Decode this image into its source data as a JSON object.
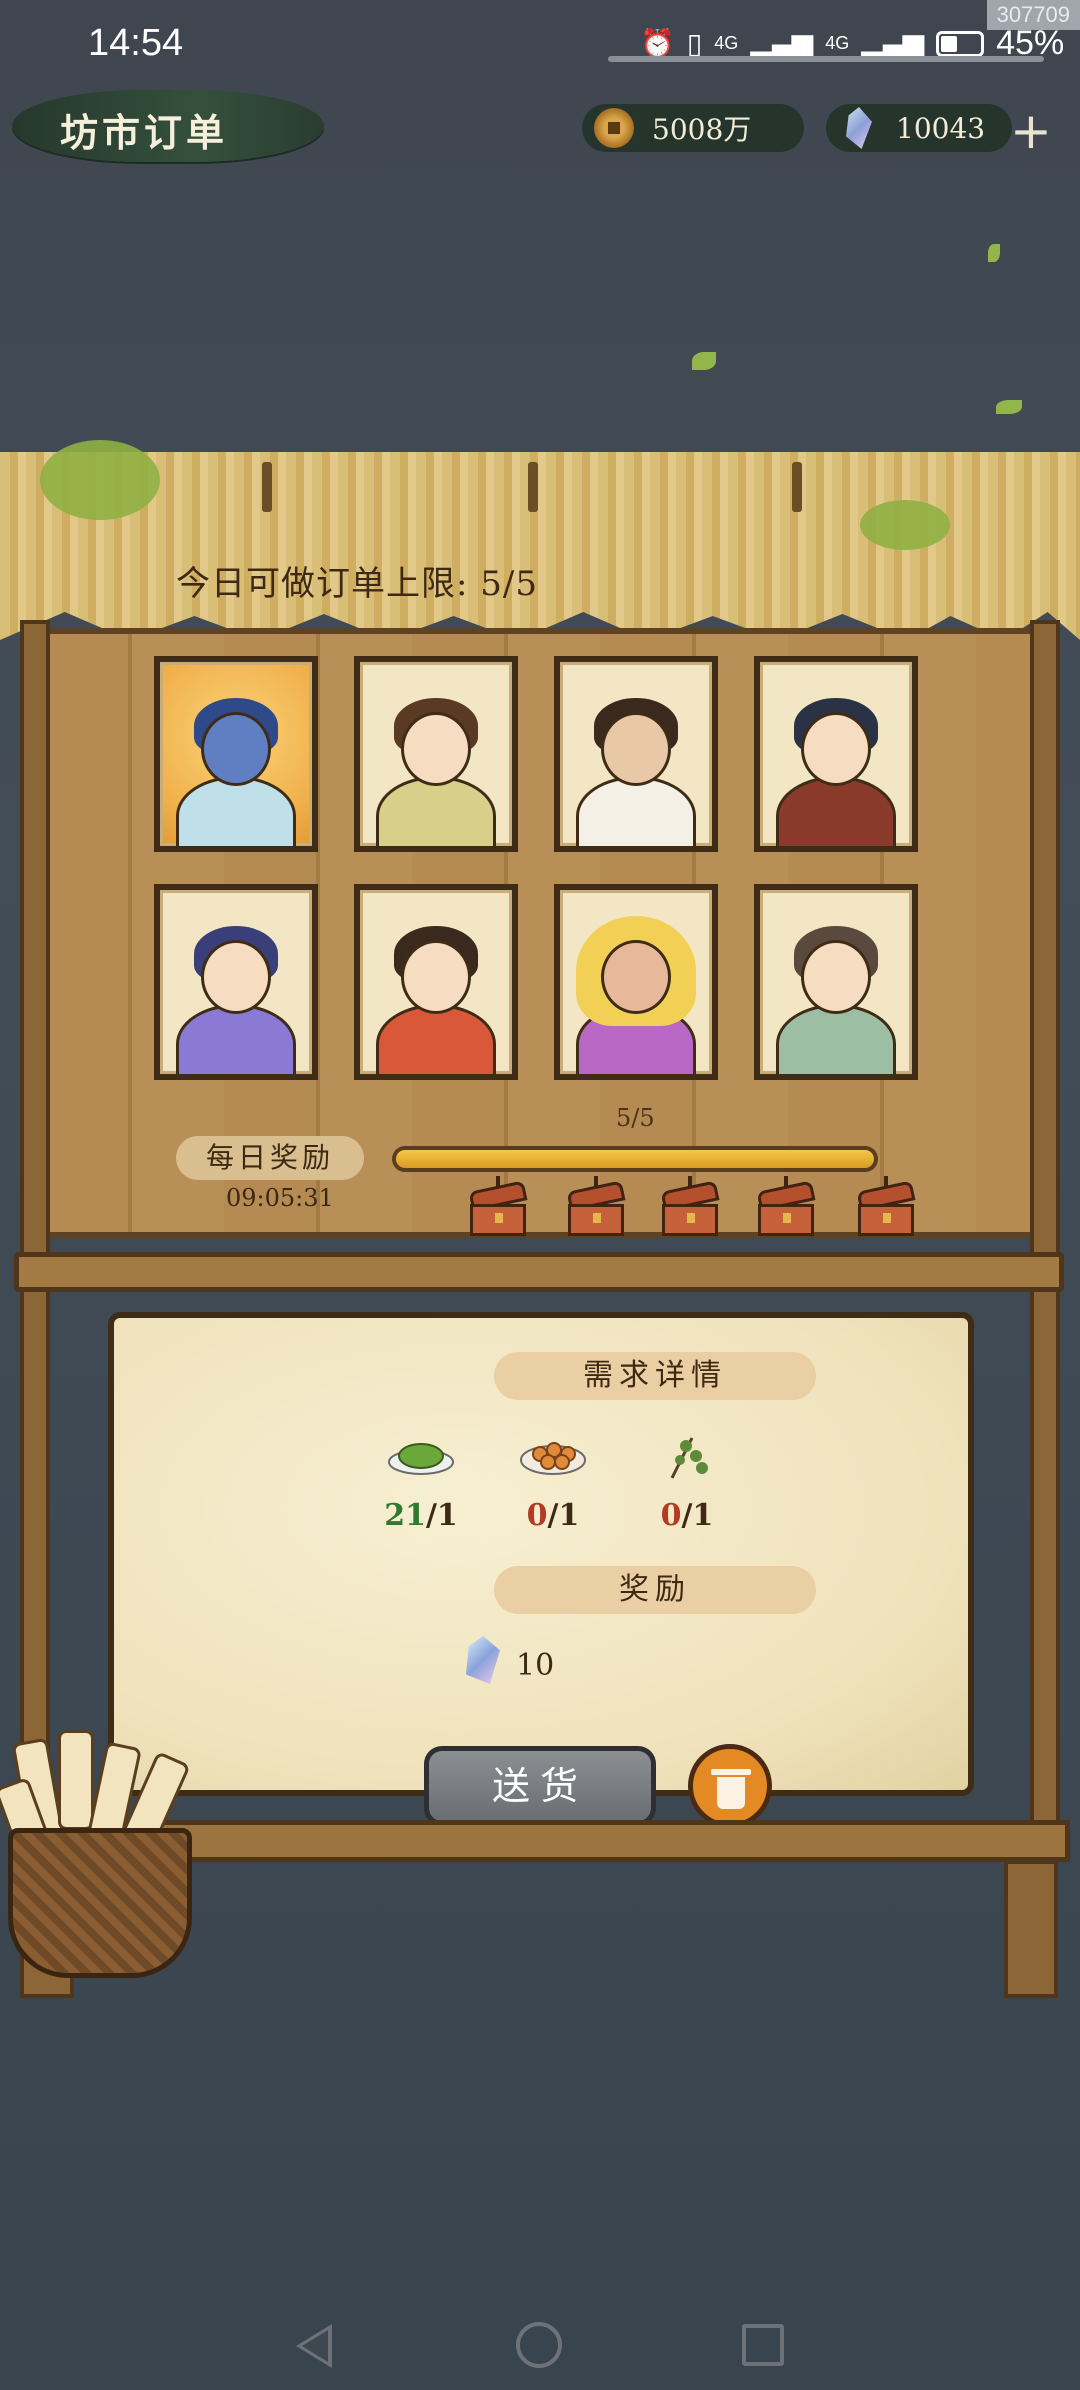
{
  "status_bar": {
    "time": "14:54",
    "network_1": "4G",
    "network_2": "4G",
    "battery": "45%",
    "build_tag": "307709"
  },
  "header": {
    "title": "坊市订单",
    "coins": "5008万",
    "gems": "10043",
    "coin_icon": "copper-coin-icon",
    "gem_icon": "spirit-crystal-icon",
    "add_icon": "plus-icon"
  },
  "orders": {
    "limit_text": "今日可做订单上限: 5/5",
    "customers": [
      {
        "name": "dragon-scholar",
        "selected": true
      },
      {
        "name": "young-lady"
      },
      {
        "name": "old-herbalist"
      },
      {
        "name": "young-farmer"
      },
      {
        "name": "elf-maiden"
      },
      {
        "name": "merchant-abacus"
      },
      {
        "name": "golden-hair-dancer"
      },
      {
        "name": "farm-girl"
      }
    ]
  },
  "daily_reward": {
    "label": "每日奖励",
    "timer": "09:05:31",
    "progress_text": "5/5",
    "progress_value": 1.0,
    "chests": 5
  },
  "details": {
    "title": "需求详情",
    "items": [
      {
        "icon": "vegetable-dish-icon",
        "have": "21",
        "need": "/1"
      },
      {
        "icon": "steamed-buns-icon",
        "have": "0",
        "need": "/1"
      },
      {
        "icon": "herb-branch-icon",
        "have": "0",
        "need": "/1"
      }
    ],
    "reward_title": "奖励",
    "reward_amount": "10"
  },
  "actions": {
    "deliver": "送货"
  },
  "colors": {
    "have_ok": "#2f7a2c",
    "have_no": "#b53a26",
    "progress": "#f0b830"
  }
}
